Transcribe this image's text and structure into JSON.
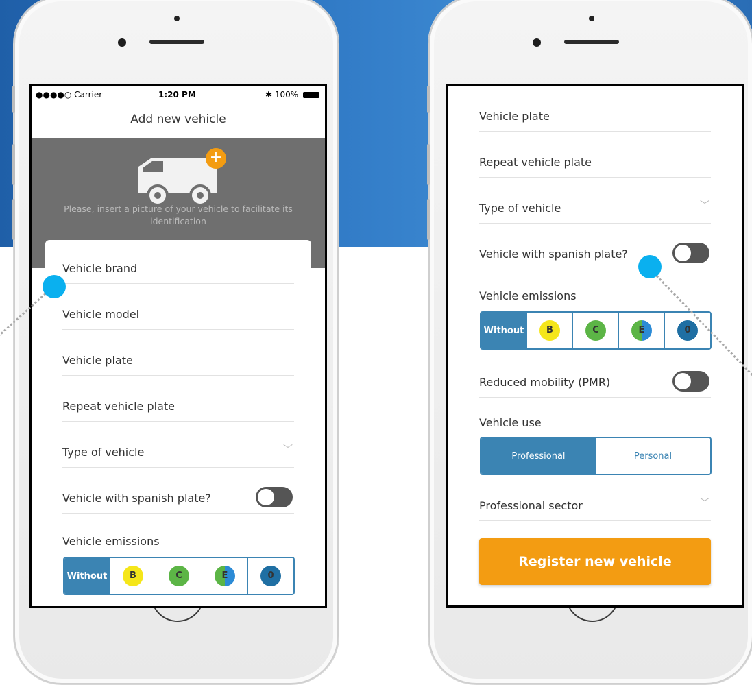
{
  "colors": {
    "brand_blue": "#3b84b3",
    "accent_orange": "#f39c12",
    "pointer_dot": "#0ab0ef",
    "emission_B": "#f5e61a",
    "emission_C": "#5cb546",
    "emission_E": "#2c8bd6",
    "emission_0": "#1f6fa3"
  },
  "left_screen": {
    "status": {
      "carrier": "●●●●○ Carrier",
      "time": "1:20 PM",
      "battery": "100%"
    },
    "title": "Add new vehicle",
    "photo_hint": "Please, insert a picture of your vehicle to facilitate its identification",
    "plus_icon": "+",
    "fields": [
      "Vehicle brand",
      "Vehicle model",
      "Vehicle plate",
      "Repeat vehicle plate",
      "Type of vehicle"
    ],
    "spanish_plate_label": "Vehicle with spanish plate?",
    "emissions_label": "Vehicle emissions",
    "emissions_options": [
      "Without",
      "B",
      "C",
      "E",
      "0"
    ]
  },
  "right_screen": {
    "fields": [
      "Vehicle plate",
      "Repeat vehicle plate",
      "Type of vehicle"
    ],
    "spanish_plate_label": "Vehicle with spanish plate?",
    "emissions_label": "Vehicle emissions",
    "emissions_options": [
      "Without",
      "B",
      "C",
      "E",
      "0"
    ],
    "pmr_label": "Reduced mobility (PMR)",
    "use_label": "Vehicle use",
    "use_options": [
      "Professional",
      "Personal"
    ],
    "sector_label": "Professional sector",
    "register_button": "Register new vehicle"
  }
}
